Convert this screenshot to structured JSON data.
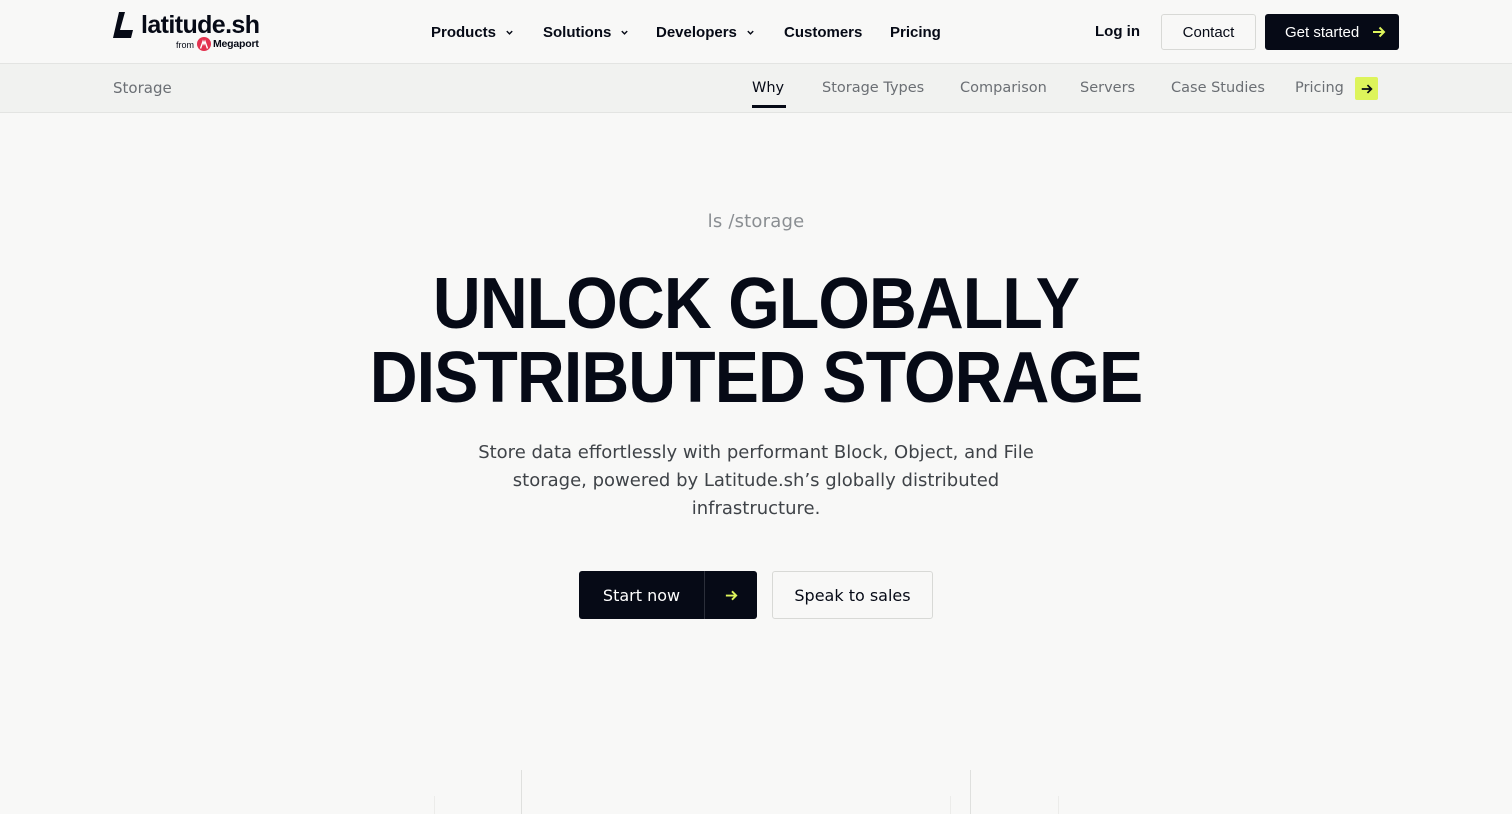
{
  "brand": {
    "name": "latitude.sh",
    "from_label": "from",
    "parent": "Megaport"
  },
  "topnav": {
    "menu": [
      {
        "label": "Products",
        "has_dropdown": true
      },
      {
        "label": "Solutions",
        "has_dropdown": true
      },
      {
        "label": "Developers",
        "has_dropdown": true
      },
      {
        "label": "Customers",
        "has_dropdown": false
      },
      {
        "label": "Pricing",
        "has_dropdown": false
      }
    ],
    "login_label": "Log in",
    "contact_label": "Contact",
    "get_started_label": "Get started"
  },
  "subnav": {
    "title": "Storage",
    "tabs": [
      {
        "label": "Why",
        "active": true
      },
      {
        "label": "Storage Types",
        "active": false
      },
      {
        "label": "Comparison",
        "active": false
      },
      {
        "label": "Servers",
        "active": false
      },
      {
        "label": "Case Studies",
        "active": false
      },
      {
        "label": "Pricing",
        "active": false
      }
    ]
  },
  "hero": {
    "eyebrow": "ls /storage",
    "headline_line1": "UNLOCK GLOBALLY",
    "headline_line2": "DISTRIBUTED STORAGE",
    "subtitle": "Store data effortlessly with performant Block, Object, and File storage, powered by Latitude.sh’s globally distributed infrastructure.",
    "primary_cta": "Start now",
    "secondary_cta": "Speak to sales"
  },
  "colors": {
    "background": "#f8f8f7",
    "ink": "#060a16",
    "accent": "#ddf45b",
    "megaport_red": "#e3324f",
    "muted_text": "#6b6f74"
  }
}
